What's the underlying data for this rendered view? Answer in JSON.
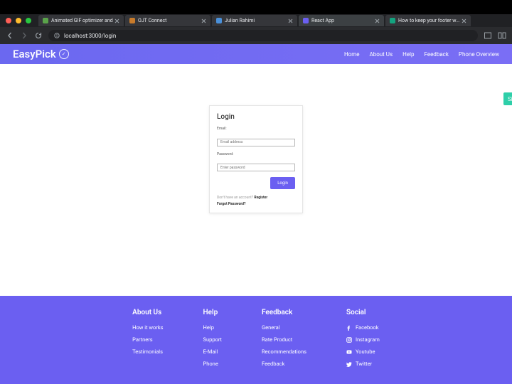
{
  "browser": {
    "tabs": [
      {
        "label": "Animated GIF optimizer and",
        "favicon": "#5aa34a"
      },
      {
        "label": "OJT Connect",
        "favicon": "#c87b2b"
      },
      {
        "label": "Julian Rahimi",
        "favicon": "#4a90d9"
      },
      {
        "label": "React App",
        "favicon": "#6b5ff1",
        "active": true
      },
      {
        "label": "How to keep your footer whe",
        "favicon": "#14a37f"
      }
    ],
    "url": "localhost:3000/login"
  },
  "header": {
    "brand": "EasyPick",
    "nav": [
      "Home",
      "About Us",
      "Help",
      "Feedback",
      "Phone Overview"
    ],
    "signup": "Si"
  },
  "login": {
    "title": "Login",
    "email_label": "Email:",
    "email_placeholder": "Email address",
    "password_label": "Password:",
    "password_placeholder": "Enter password",
    "button": "Login",
    "prompt": "Don't have an account?",
    "register": "Register",
    "forgot": "Forgot Password?"
  },
  "footer": {
    "cols": [
      {
        "title": "About Us",
        "items": [
          "How it works",
          "Partners",
          "Testimonials"
        ]
      },
      {
        "title": "Help",
        "items": [
          "Help",
          "Support",
          "E-Mail",
          "Phone"
        ]
      },
      {
        "title": "Feedback",
        "items": [
          "General",
          "Rate Product",
          "Recommendations",
          "Feedback"
        ]
      }
    ],
    "social": {
      "title": "Social",
      "items": [
        {
          "icon": "facebook",
          "label": "Facebook"
        },
        {
          "icon": "instagram",
          "label": "Instagram"
        },
        {
          "icon": "youtube",
          "label": "Youtube"
        },
        {
          "icon": "twitter",
          "label": "Twitter"
        }
      ]
    }
  }
}
